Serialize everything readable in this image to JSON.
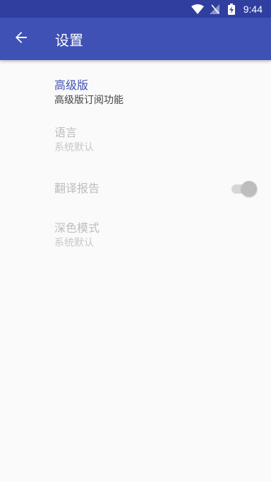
{
  "status_bar": {
    "time": "9:44",
    "icons": [
      "wifi-icon",
      "no-signal-icon",
      "battery-charging-icon"
    ]
  },
  "app_bar": {
    "title": "设置",
    "back_icon": "arrow-left-icon",
    "colors": {
      "app_bar": "#3f51b5",
      "status_bar": "#303f9f"
    }
  },
  "preferences": [
    {
      "title": "高级版",
      "summary": "高级版订阅功能",
      "enabled": true
    },
    {
      "title": "语言",
      "summary": "系统默认",
      "enabled": false
    },
    {
      "title": "翻译报告",
      "enabled": false,
      "toggle": {
        "checked": true
      }
    },
    {
      "title": "深色模式",
      "summary": "系统默认",
      "enabled": false
    }
  ]
}
